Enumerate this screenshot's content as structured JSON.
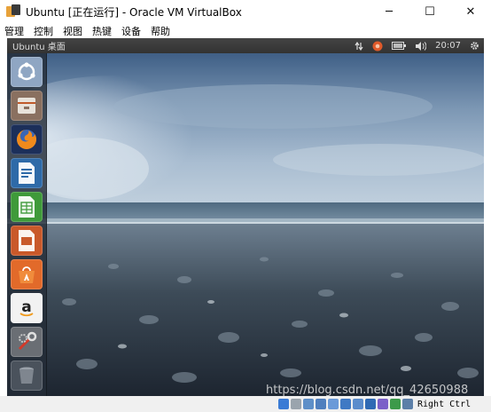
{
  "window": {
    "title": "Ubuntu [正在运行] - Oracle VM VirtualBox",
    "minimize_glyph": "─",
    "maximize_glyph": "☐",
    "close_glyph": "✕"
  },
  "menu": {
    "items": [
      "管理",
      "控制",
      "视图",
      "热键",
      "设备",
      "帮助"
    ]
  },
  "panel": {
    "title": "Ubuntu 桌面",
    "time": "20:07",
    "icons": [
      "network-icon",
      "update-notifier-icon",
      "battery-icon",
      "volume-icon",
      "settings-gear-icon"
    ]
  },
  "launcher": {
    "items": [
      "ubuntu-dash-icon",
      "files-icon",
      "firefox-icon",
      "writer-icon",
      "calc-icon",
      "impress-icon",
      "software-center-icon",
      "amazon-icon",
      "system-settings-icon",
      "trash-icon"
    ]
  },
  "statusbar": {
    "host_key": "Right Ctrl",
    "watermark": "https://blog.csdn.net/qq_42650988"
  },
  "colors": {
    "launcher_bg": "#232c37",
    "panel_bg": "#3c3c3c",
    "statusbar_bg": "#f0f0f0"
  }
}
